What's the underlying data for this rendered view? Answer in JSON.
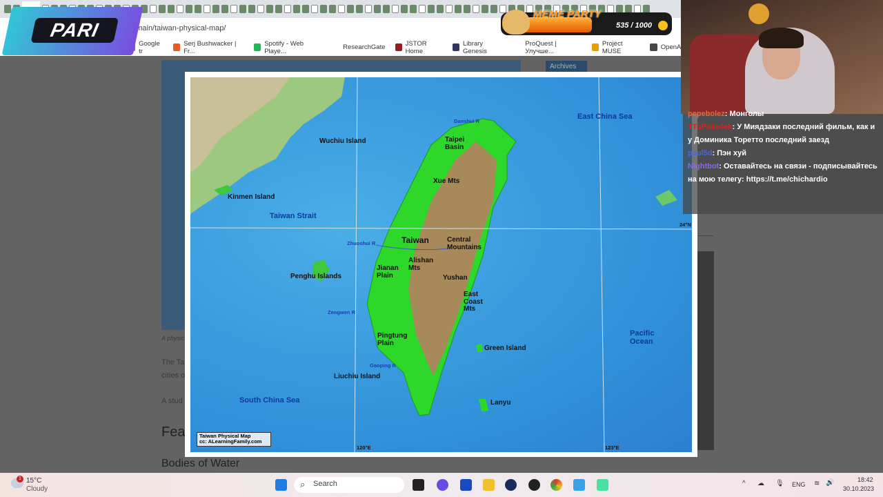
{
  "browser": {
    "url": "m/main/taiwan-physical-map/",
    "close_tab": "×",
    "bookmarks": [
      {
        "label": "Google tr",
        "color": "#4a80e0"
      },
      {
        "label": "Serj Bushwacker | Fr...",
        "color": "#f05a22"
      },
      {
        "label": "Spotify - Web Playe...",
        "color": "#1db954"
      },
      {
        "label": "ResearchGate",
        "color": "#ffffff"
      },
      {
        "label": "JSTOR Home",
        "color": "#9a1c20"
      },
      {
        "label": "Library Genesis",
        "color": "#333366"
      },
      {
        "label": "ProQuest | Улучше...",
        "color": "#ffffff"
      },
      {
        "label": "Project MUSE",
        "color": "#e8a000"
      },
      {
        "label": "OpenAI",
        "color": "#444444"
      }
    ]
  },
  "overlay": {
    "sponsor_logo": "PARI",
    "meme_title": "MEME PARTY",
    "meme_count": "535 / 1000",
    "meme_progress": 0.535
  },
  "page": {
    "archives": "Archives",
    "caption": "A physic",
    "para1a": "The Ta",
    "para1b": "cities o",
    "para2": "A stud",
    "heading": "Fea",
    "subheading": "Bodies of Water"
  },
  "map": {
    "labels": {
      "east_china_sea": "East China Sea",
      "wuchiu": "Wuchiu Island",
      "kinmen": "Kinmen Island",
      "taiwan_strait": "Taiwan Strait",
      "penghu": "Penghu Islands",
      "south_china_sea": "South China Sea",
      "liuchiu": "Liuchiu Island",
      "pacific": "Pacific\nOcean",
      "green_island": "Green Island",
      "lanyu": "Lanyu",
      "taiwan": "Taiwan",
      "taipei": "Taipei\nBasin",
      "xue": "Xue Mts",
      "central": "Central\nMountains",
      "alishan": "Alishan\nMts",
      "jianan": "Jianan\nPlain",
      "yushan": "Yushan",
      "east_coast": "East\nCoast\nMts",
      "pingtung": "Pingtung\nPlain",
      "danshui": "Danshui R",
      "zhuoshui": "Zhuoshui R",
      "zengwen": "Zengwen R",
      "gaoping": "Gaoping R",
      "lat": "24°N",
      "lon1": "120°E",
      "lon2": "123°E"
    },
    "credit_line1": "Taiwan Physical Map",
    "credit_line2": "cc: ALearningFamily.com"
  },
  "chat": [
    {
      "user": "pepebolez",
      "color": "#e06a40",
      "text": "Монголы"
    },
    {
      "user": "TTuPoIIo4ek",
      "color": "#e02020",
      "text": "У Миядзаки последний фильм, как и у Доминика Торетто последний заезд"
    },
    {
      "user": "paul5d",
      "color": "#4a6ad0",
      "text": "Пэн хуй"
    },
    {
      "user": "Nightbot",
      "color": "#8a6ae0",
      "text": "Оставайтесь на связи - подписывайтесь на мою телегу: https://t.me/chichardio"
    }
  ],
  "taskbar": {
    "weather_temp": "15°C",
    "weather_desc": "Cloudy",
    "weather_badge": "1",
    "search": "Search",
    "lang": "ENG",
    "time": "18:42",
    "date": "30.10.2023"
  }
}
